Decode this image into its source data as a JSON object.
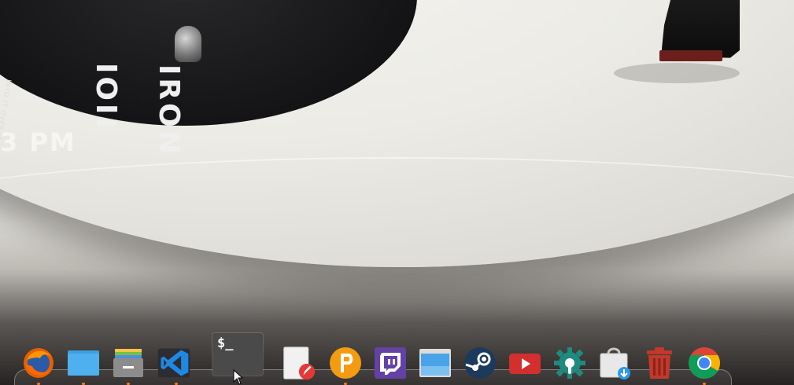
{
  "desktop": {
    "clock_text": "3 PM",
    "record_label_big": "IOII",
    "record_label_big2": "IRON",
    "record_label_small": "INTO IT OVER IT"
  },
  "terminal": {
    "prompt": "$_"
  },
  "dock": {
    "items": [
      {
        "name": "firefox",
        "icon": "firefox-icon",
        "running": true
      },
      {
        "name": "files",
        "icon": "folder-icon",
        "running": true
      },
      {
        "name": "archive",
        "icon": "archive-icon",
        "running": true
      },
      {
        "name": "vscode",
        "icon": "vscode-icon",
        "running": true
      },
      {
        "name": "terminal",
        "icon": "terminal-icon",
        "running": false
      },
      {
        "name": "text-editor",
        "icon": "text-editor-icon",
        "running": false
      },
      {
        "name": "pushbullet",
        "icon": "pushbullet-icon",
        "running": true
      },
      {
        "name": "twitch",
        "icon": "twitch-icon",
        "running": false
      },
      {
        "name": "desktop",
        "icon": "window-icon",
        "running": false
      },
      {
        "name": "steam",
        "icon": "steam-icon",
        "running": false
      },
      {
        "name": "youtube",
        "icon": "youtube-icon",
        "running": false
      },
      {
        "name": "settings",
        "icon": "gear-icon",
        "running": false
      },
      {
        "name": "appcenter",
        "icon": "appcenter-icon",
        "running": false
      },
      {
        "name": "trash",
        "icon": "trash-icon",
        "running": false
      },
      {
        "name": "chrome",
        "icon": "chrome-icon",
        "running": true
      }
    ]
  },
  "colors": {
    "accent_running": "#ff7a1a",
    "record_black": "#141416"
  }
}
